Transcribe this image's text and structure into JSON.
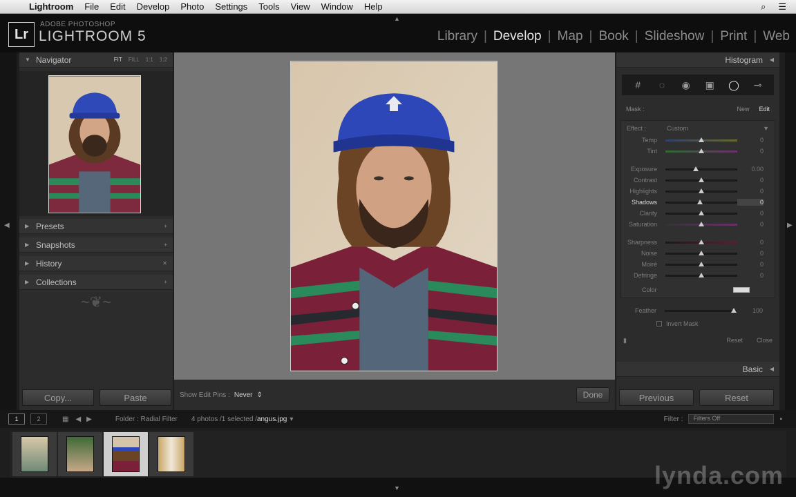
{
  "menubar": {
    "items": [
      "Lightroom",
      "File",
      "Edit",
      "Develop",
      "Photo",
      "Settings",
      "Tools",
      "View",
      "Window",
      "Help"
    ]
  },
  "brand": {
    "logo": "Lr",
    "small": "ADOBE PHOTOSHOP",
    "big": "LIGHTROOM 5"
  },
  "modules": [
    "Library",
    "Develop",
    "Map",
    "Book",
    "Slideshow",
    "Print",
    "Web"
  ],
  "active_module": "Develop",
  "left_panel": {
    "navigator": "Navigator",
    "nav_options": [
      "FIT",
      "FILL",
      "1:1",
      "1:2"
    ],
    "sections": [
      "Presets",
      "Snapshots",
      "History",
      "Collections"
    ],
    "copy": "Copy...",
    "paste": "Paste"
  },
  "toolbar": {
    "label": "Show Edit Pins :",
    "value": "Never",
    "done": "Done"
  },
  "right_panel": {
    "histogram": "Histogram",
    "mask_label": "Mask :",
    "mask_new": "New",
    "mask_edit": "Edit",
    "effect_label": "Effect :",
    "effect_value": "Custom",
    "sliders": [
      {
        "label": "Temp",
        "value": "0"
      },
      {
        "label": "Tint",
        "value": "0"
      },
      {
        "label": "Exposure",
        "value": "0.00"
      },
      {
        "label": "Contrast",
        "value": "0"
      },
      {
        "label": "Highlights",
        "value": "0"
      },
      {
        "label": "Shadows",
        "value": "0"
      },
      {
        "label": "Clarity",
        "value": "0"
      },
      {
        "label": "Saturation",
        "value": "0"
      },
      {
        "label": "Sharpness",
        "value": "0"
      },
      {
        "label": "Noise",
        "value": "0"
      },
      {
        "label": "Moiré",
        "value": "0"
      },
      {
        "label": "Defringe",
        "value": "0"
      }
    ],
    "color": "Color",
    "feather_label": "Feather",
    "feather_value": "100",
    "invert": "Invert Mask",
    "reset": "Reset",
    "close": "Close",
    "basic": "Basic",
    "previous": "Previous",
    "reset_btn": "Reset"
  },
  "filmstrip": {
    "screen1": "1",
    "screen2": "2",
    "folder": "Folder : Radial Filter",
    "count": "4 photos /1 selected /",
    "filename": "angus.jpg",
    "filter_label": "Filter :",
    "filter_value": "Filters Off"
  },
  "watermark": "lynda.com"
}
